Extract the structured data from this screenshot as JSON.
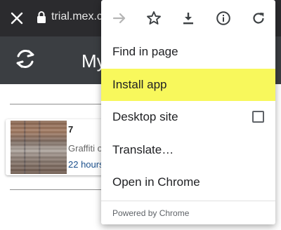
{
  "browser": {
    "url": "trial.mex.com",
    "close_icon": "close-icon",
    "lock_icon": "lock-icon"
  },
  "site": {
    "header_icon": "refresh-icon",
    "title": "My"
  },
  "card": {
    "number": "7",
    "description": "Graffiti o",
    "time": "22 hours"
  },
  "menu": {
    "toolbar": [
      "forward-arrow-icon",
      "star-icon",
      "download-icon",
      "info-icon",
      "reload-icon"
    ],
    "items": [
      {
        "label": "Find in page"
      },
      {
        "label": "Install app",
        "highlighted": true
      },
      {
        "label": "Desktop site",
        "checkbox": false
      },
      {
        "label": "Translate…"
      },
      {
        "label": "Open in Chrome"
      }
    ],
    "footer": "Powered by Chrome"
  },
  "colors": {
    "chrome_bar": "#2b2b2e",
    "site_header": "#3b3e42",
    "highlight": "#f8f85c",
    "link_blue": "#1a4f8c"
  }
}
